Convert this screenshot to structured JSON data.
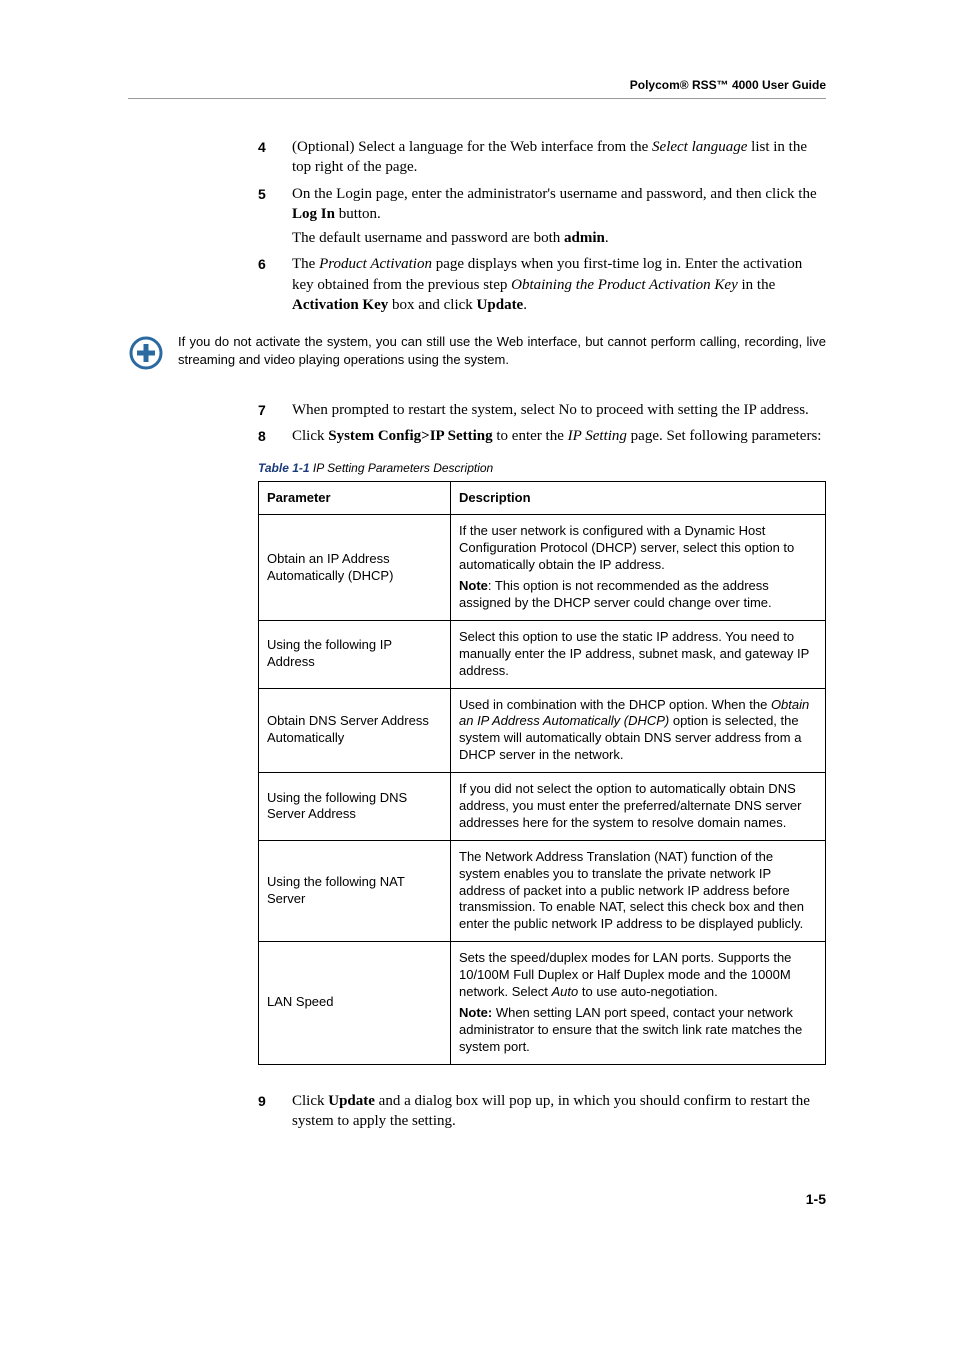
{
  "header": {
    "title": "Polycom® RSS™ 4000 User Guide"
  },
  "steps": {
    "s4": {
      "num": "4",
      "prefix": "(Optional) Select a language for the Web interface from the ",
      "italic1": "Select language",
      "suffix": " list in the top right of the page."
    },
    "s5": {
      "num": "5",
      "line1a": "On the Login page, enter the administrator's username and password, and then click the ",
      "bold1": "Log In",
      "line1b": " button.",
      "line2a": "The default username and password are both ",
      "bold2": "admin",
      "line2b": "."
    },
    "s6": {
      "num": "6",
      "a": "The ",
      "i1": "Product Activation",
      "b": " page displays when you first-time log in. Enter the activation key obtained from the previous step ",
      "i2": "Obtaining the Product Activation Key",
      "c": " in the ",
      "b1": "Activation Key",
      "d": " box and click ",
      "b2": "Update",
      "e": "."
    },
    "s7": {
      "num": "7",
      "text": "When prompted to restart the system, select No to proceed with setting the IP address."
    },
    "s8": {
      "num": "8",
      "a": "Click ",
      "b1": "System Config>IP Setting",
      "b": " to enter the ",
      "i1": "IP Setting",
      "c": " page. Set following parameters:"
    },
    "s9": {
      "num": "9",
      "a": "Click ",
      "b1": "Update",
      "b": " and a dialog box will pop up, in which you should confirm to restart the system to apply the setting."
    }
  },
  "note1": {
    "text": "If you do not activate the system, you can still use the Web interface, but cannot perform calling, recording, live streaming and video playing operations using the system."
  },
  "table": {
    "caption_label": "Table 1-1",
    "caption_title": " IP Setting Parameters Description",
    "h1": "Parameter",
    "h2": "Description",
    "rows": {
      "r1": {
        "param": "Obtain an IP Address Automatically (DHCP)",
        "desc1": "If the user network is configured with a Dynamic Host Configuration Protocol (DHCP) server, select this option to automatically obtain the IP address.",
        "noteLabel": "Note",
        "noteText": ": This option is not recommended as the address assigned by the DHCP server could change over time."
      },
      "r2": {
        "param": "Using the following IP Address",
        "desc": "Select this option to use the static IP address. You need to manually enter the IP address, subnet mask, and gateway IP address."
      },
      "r3": {
        "param": "Obtain DNS Server Address Automatically",
        "descA": "Used in combination with the DHCP option. When the ",
        "descI": "Obtain an IP Address Automatically (DHCP)",
        "descB": " option is selected, the system will automatically obtain DNS server address from a DHCP server in the network."
      },
      "r4": {
        "param": "Using the following DNS Server Address",
        "desc": "If you did not select the option to automatically obtain DNS address, you must enter the preferred/alternate DNS server addresses here for the system to resolve domain names."
      },
      "r5": {
        "param": "Using the following NAT Server",
        "desc": "The Network Address Translation (NAT) function of the system enables you to translate the private network IP address of packet into a public network IP address before transmission. To enable NAT, select this check box and then enter the public network IP address to be displayed publicly."
      },
      "r6": {
        "param": "LAN Speed",
        "descA": "Sets the speed/duplex modes for LAN ports. Supports the 10/100M Full Duplex or Half Duplex mode and the 1000M network. Select ",
        "descI": "Auto",
        "descB": " to use auto-negotiation.",
        "noteLabel": "Note:",
        "noteText": " When setting LAN port speed, contact your network administrator to ensure that the switch link rate matches the system port."
      }
    }
  },
  "footer": {
    "pagenum": "1-5"
  }
}
